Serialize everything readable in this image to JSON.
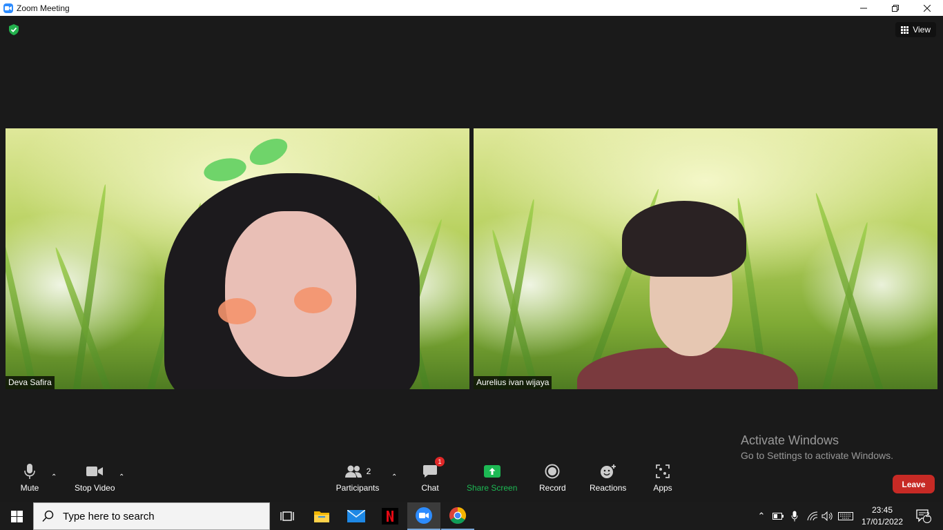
{
  "window": {
    "title": "Zoom Meeting",
    "controls": [
      "minimize",
      "restore",
      "close"
    ]
  },
  "meeting": {
    "view_label": "View",
    "participants": [
      {
        "name": "Deva Safira"
      },
      {
        "name": "Aurelius ivan wijaya"
      }
    ]
  },
  "toolbar": {
    "mute_label": "Mute",
    "stop_video_label": "Stop Video",
    "participants_label": "Participants",
    "participants_count": "2",
    "chat_label": "Chat",
    "chat_badge": "1",
    "share_screen_label": "Share Screen",
    "record_label": "Record",
    "reactions_label": "Reactions",
    "apps_label": "Apps",
    "leave_label": "Leave"
  },
  "watermark": {
    "title": "Activate Windows",
    "subtitle": "Go to Settings to activate Windows."
  },
  "taskbar": {
    "search_placeholder": "Type here to search",
    "apps": [
      "task-view",
      "file-explorer",
      "mail",
      "netflix",
      "zoom",
      "chrome"
    ],
    "time": "23:45",
    "date": "17/01/2022",
    "notification_count": "2"
  },
  "colors": {
    "share_green": "#1db954",
    "leave_red": "#c72a25",
    "zoom_blue": "#2d8cff",
    "badge_red": "#e02828"
  }
}
